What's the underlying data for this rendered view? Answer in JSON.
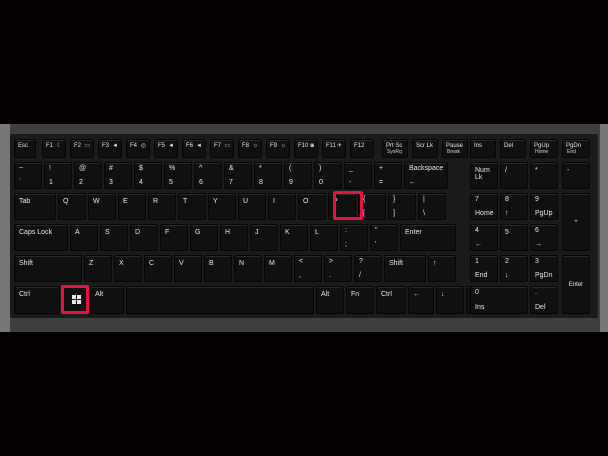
{
  "keyboard": {
    "fn_row": [
      {
        "label": "Esc"
      },
      {
        "label": "F1",
        "icon": "moon-icon",
        "glyph": "☾"
      },
      {
        "label": "F2",
        "icon": "screen-icon",
        "glyph": "▭"
      },
      {
        "label": "F3",
        "icon": "speaker-mute-icon",
        "glyph": "◄"
      },
      {
        "label": "F4",
        "icon": "disc-icon",
        "glyph": "◎"
      },
      {
        "label": "F5",
        "icon": "volume-down-icon",
        "glyph": "◄"
      },
      {
        "label": "F6",
        "icon": "volume-up-icon",
        "glyph": "◄"
      },
      {
        "label": "F7",
        "icon": "display-switch-icon",
        "glyph": "▭"
      },
      {
        "label": "F8",
        "icon": "brightness-down-icon",
        "glyph": "☼"
      },
      {
        "label": "F9",
        "icon": "brightness-up-icon",
        "glyph": "☼"
      },
      {
        "label": "F10",
        "icon": "camera-icon",
        "glyph": "◙"
      },
      {
        "label": "F11",
        "icon": "airplane-icon",
        "glyph": "✈"
      },
      {
        "label": "F12",
        "icon": "",
        "glyph": ""
      },
      {
        "label": "Prt Sc",
        "label2": "SysRq"
      },
      {
        "label": "Scr Lk"
      },
      {
        "label": "Pause",
        "label2": "Break"
      },
      {
        "label": "Ins"
      },
      {
        "label": "Del"
      },
      {
        "label": "PgUp",
        "label2": "Home"
      },
      {
        "label": "PgDn",
        "label2": "End"
      }
    ],
    "num_row": [
      {
        "top": "~",
        "bot": "`"
      },
      {
        "top": "!",
        "bot": "1"
      },
      {
        "top": "@",
        "bot": "2"
      },
      {
        "top": "#",
        "bot": "3"
      },
      {
        "top": "$",
        "bot": "4"
      },
      {
        "top": "%",
        "bot": "5"
      },
      {
        "top": "^",
        "bot": "6"
      },
      {
        "top": "&",
        "bot": "7"
      },
      {
        "top": "*",
        "bot": "8"
      },
      {
        "top": "(",
        "bot": "9"
      },
      {
        "top": ")",
        "bot": "0"
      },
      {
        "top": "_",
        "bot": "-"
      },
      {
        "top": "+",
        "bot": "="
      },
      {
        "top": "Backspace",
        "bot": "←"
      }
    ],
    "qwerty_row": [
      "Tab",
      "Q",
      "W",
      "E",
      "R",
      "T",
      "Y",
      "U",
      "I",
      "O",
      "P",
      "{ [",
      "} ]",
      "| \\"
    ],
    "home_row": [
      "Caps Lock",
      "A",
      "S",
      "D",
      "F",
      "G",
      "H",
      "J",
      "K",
      "L",
      ": ;",
      "\" '",
      "Enter"
    ],
    "shift_row": [
      "Shift",
      "Z",
      "X",
      "C",
      "V",
      "B",
      "N",
      "M",
      "< ,",
      "> .",
      "? /",
      "Shift",
      "↑"
    ],
    "bottom_row": [
      "Ctrl",
      "Win",
      "Alt",
      "",
      "Alt",
      "Fn",
      "Ctrl",
      "←",
      "↓",
      "→"
    ],
    "numpad": {
      "row1": [
        "Num Lk",
        "/",
        "*",
        "-"
      ],
      "row2": [
        {
          "top": "7",
          "bot": "Home"
        },
        {
          "top": "8",
          "bot": "↑"
        },
        {
          "top": "9",
          "bot": "PgUp"
        },
        "+"
      ],
      "row3": [
        {
          "top": "4",
          "bot": "←"
        },
        "5",
        {
          "top": "6",
          "bot": "→"
        }
      ],
      "row4": [
        {
          "top": "1",
          "bot": "End"
        },
        {
          "top": "2",
          "bot": "↓"
        },
        {
          "top": "3",
          "bot": "PgDn"
        },
        "Enter"
      ],
      "row5": [
        {
          "top": "0",
          "bot": "Ins"
        },
        {
          "top": ".",
          "bot": "Del"
        }
      ]
    },
    "highlight_color": "#e3143f",
    "highlighted_keys": [
      "win-key",
      "p-key"
    ]
  }
}
